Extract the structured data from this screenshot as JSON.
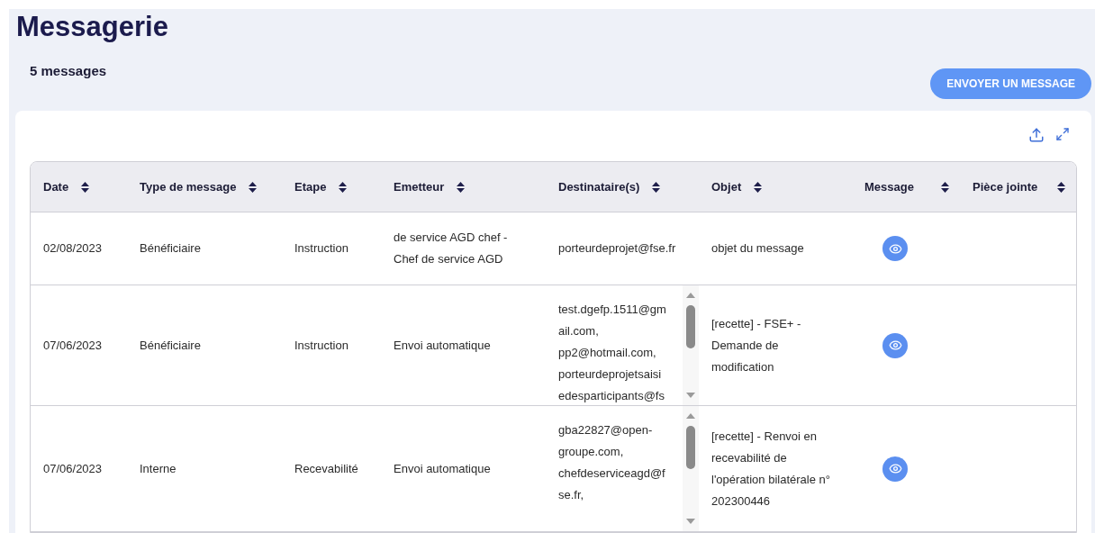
{
  "title": "Messagerie",
  "count": "5 messages",
  "send_button": "ENVOYER UN MESSAGE",
  "table": {
    "columns": [
      "Date",
      "Type de message",
      "Etape",
      "Emetteur",
      "Destinataire(s)",
      "Objet",
      "Message",
      "Pièce jointe"
    ],
    "rows": [
      {
        "date": "02/08/2023",
        "type": "Bénéficiaire",
        "etape": "Instruction",
        "emetteur": "de service AGD chef - Chef de service AGD",
        "recipients": [
          "porteurdeprojet@fse.fr"
        ],
        "scrollable": false,
        "objet": "objet du message"
      },
      {
        "date": "07/06/2023",
        "type": "Bénéficiaire",
        "etape": "Instruction",
        "emetteur": "Envoi automatique",
        "recipients": [
          "test.dgefp.1511@gm",
          "ail.com,",
          "pp2@hotmail.com,",
          "porteurdeprojetsaisi",
          "edesparticipants@fs"
        ],
        "scrollable": true,
        "objet": "[recette] - FSE+ - Demande de modification"
      },
      {
        "date": "07/06/2023",
        "type": "Interne",
        "etape": "Recevabilité",
        "emetteur": "Envoi automatique",
        "recipients": [
          "gba22827@open-",
          "groupe.com,",
          "chefdeserviceagd@f",
          "se.fr,"
        ],
        "scrollable": true,
        "objet": "[recette] - Renvoi en recevabilité de l'opération bilatérale n° 202300446"
      }
    ]
  }
}
